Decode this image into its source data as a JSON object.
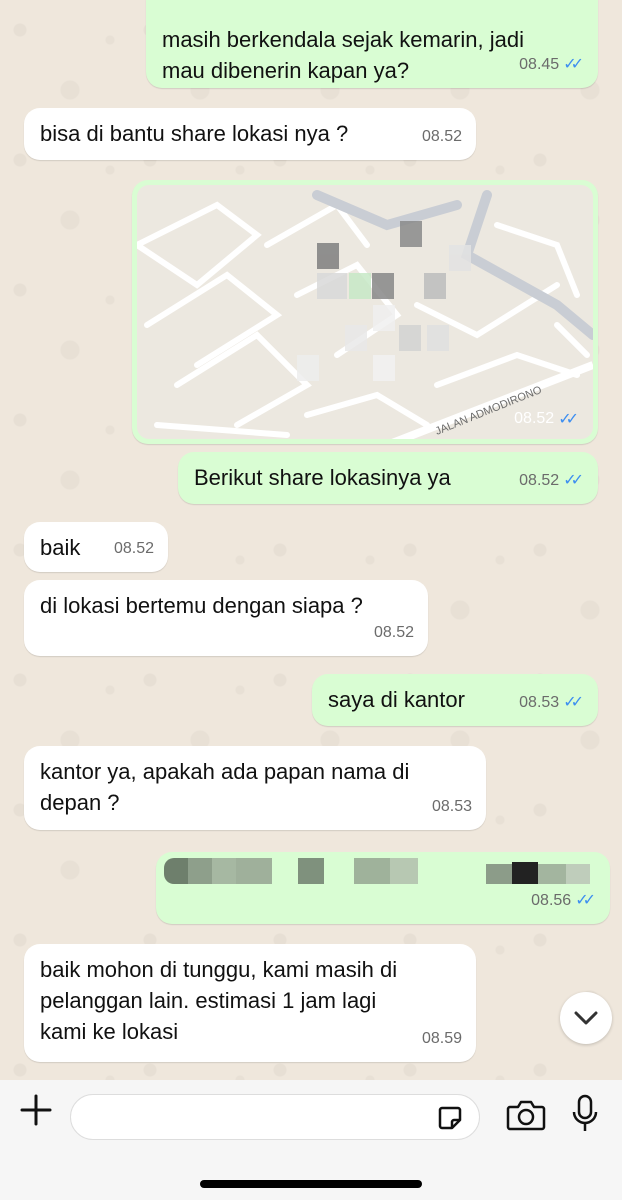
{
  "messages": {
    "m0": {
      "text_l2": "masih berkendala sejak kemarin, jadi",
      "text_l3": "mau dibenerin kapan ya?",
      "time": "08.45"
    },
    "m1": {
      "text": "bisa di bantu share lokasi nya ?",
      "time": "08.52"
    },
    "map": {
      "street": "JALAN ADMODIRONO",
      "time": "08.52"
    },
    "m2": {
      "text": "Berikut share lokasinya ya",
      "time": "08.52"
    },
    "m3": {
      "text": "baik",
      "time": "08.52"
    },
    "m4": {
      "text": "di lokasi bertemu dengan siapa ?",
      "time": "08.52"
    },
    "m5": {
      "text": "saya di kantor",
      "time": "08.53"
    },
    "m6": {
      "line1": "kantor ya, apakah ada papan nama di",
      "line2": "depan ?",
      "time": "08.53"
    },
    "m7": {
      "time": "08.56"
    },
    "m8": {
      "line1": "baik mohon di tunggu, kami masih di",
      "line2": "pelanggan lain. estimasi 1 jam lagi",
      "line3": "kami ke lokasi",
      "time": "08.59"
    }
  },
  "icons": {
    "read_ticks": "double-check-icon",
    "scroll_down": "chevron-down-icon",
    "attach": "plus-icon",
    "sticker": "sticker-icon",
    "camera": "camera-icon",
    "mic": "microphone-icon"
  },
  "colors": {
    "outgoing_bubble": "#d9fdd3",
    "incoming_bubble": "#ffffff",
    "read_tick": "#3d8ef0"
  }
}
